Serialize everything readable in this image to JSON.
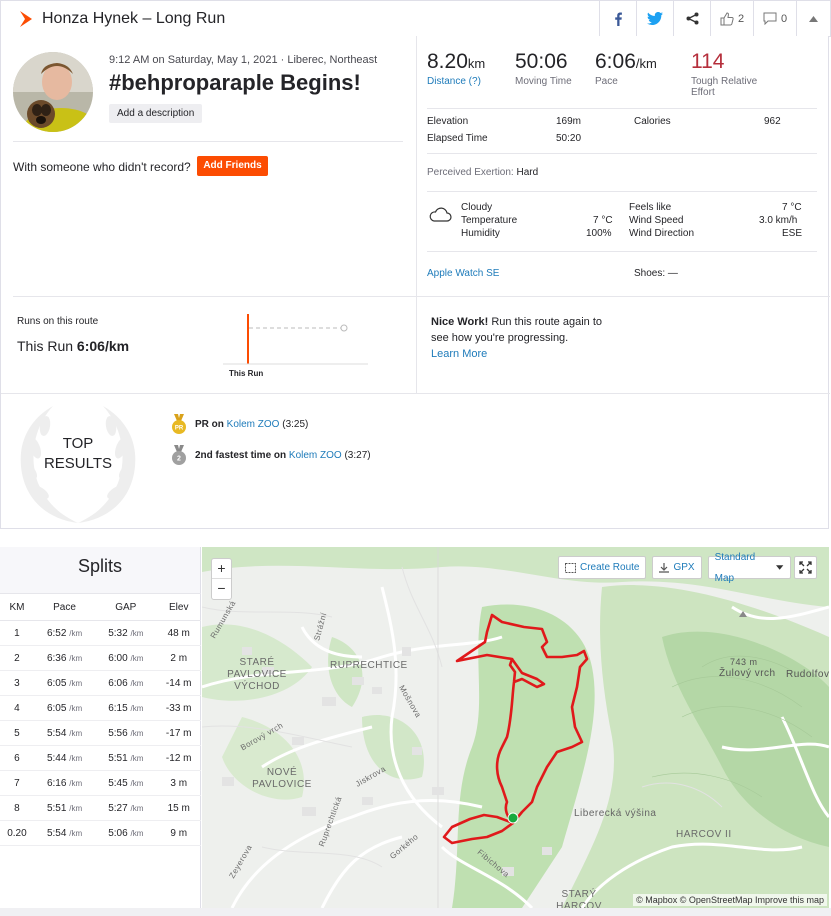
{
  "header": {
    "title": "Honza Hynek – Long Run",
    "kudos_count": "2",
    "comments_count": "0"
  },
  "activity": {
    "meta": "9:12 AM on Saturday, May 1, 2021 · Liberec, Northeast",
    "name": "#behproparaple Begins!",
    "add_description": "Add a description",
    "with_someone": "With someone who didn't record?",
    "add_friends": "Add Friends"
  },
  "stats": {
    "distance_value": "8.20",
    "distance_unit": "km",
    "distance_label": "Distance (?)",
    "moving_time_value": "50:06",
    "moving_time_label": "Moving Time",
    "pace_value": "6:06",
    "pace_unit": "/km",
    "pace_label": "Pace",
    "effort_value": "114",
    "effort_label_1": "Tough Relative",
    "effort_label_2": "Effort"
  },
  "details": {
    "elevation_label": "Elevation",
    "elevation_value": "169m",
    "calories_label": "Calories",
    "calories_value": "962",
    "elapsed_label": "Elapsed Time",
    "elapsed_value": "50:20",
    "perceived_label": "Perceived Exertion:",
    "perceived_value": "Hard"
  },
  "weather": {
    "condition": "Cloudy",
    "temperature_label": "Temperature",
    "temperature_value": "7 °C",
    "humidity_label": "Humidity",
    "humidity_value": "100%",
    "feels_like_label": "Feels like",
    "feels_like_value": "7 °C",
    "wind_speed_label": "Wind Speed",
    "wind_speed_value": "3.0 km/h",
    "wind_dir_label": "Wind Direction",
    "wind_dir_value": "ESE"
  },
  "device": {
    "name": "Apple Watch SE",
    "shoes_label": "Shoes: —"
  },
  "route": {
    "title": "Runs on this route",
    "this_run_prefix": "This Run",
    "this_run_pace": "6:06/km",
    "chart_label": "This Run",
    "nice_bold": "Nice Work!",
    "nice_text": " Run this route again to see how you're progressing.",
    "learn_more": "Learn More"
  },
  "top_results": {
    "line1": "TOP",
    "line2": "RESULTS",
    "items": [
      {
        "badge": "PR",
        "prefix": "PR on ",
        "segment": "Kolem ZOO",
        "time": " (3:25)"
      },
      {
        "badge": "2",
        "prefix": "2nd fastest time on ",
        "segment": "Kolem ZOO",
        "time": " (3:27)"
      }
    ]
  },
  "splits": {
    "title": "Splits",
    "headers": [
      "KM",
      "Pace",
      "GAP",
      "Elev"
    ],
    "rows": [
      {
        "km": "1",
        "pace": "6:52",
        "gap": "5:32",
        "elev": "48 m"
      },
      {
        "km": "2",
        "pace": "6:36",
        "gap": "6:00",
        "elev": "2 m"
      },
      {
        "km": "3",
        "pace": "6:05",
        "gap": "6:06",
        "elev": "-14 m"
      },
      {
        "km": "4",
        "pace": "6:05",
        "gap": "6:15",
        "elev": "-33 m"
      },
      {
        "km": "5",
        "pace": "5:54",
        "gap": "5:56",
        "elev": "-17 m"
      },
      {
        "km": "6",
        "pace": "5:44",
        "gap": "5:51",
        "elev": "-12 m"
      },
      {
        "km": "7",
        "pace": "6:16",
        "gap": "5:45",
        "elev": "3 m"
      },
      {
        "km": "8",
        "pace": "5:51",
        "gap": "5:27",
        "elev": "15 m"
      },
      {
        "km": "0.20",
        "pace": "5:54",
        "gap": "5:06",
        "elev": "9 m"
      }
    ],
    "unit": "/km"
  },
  "map": {
    "create_route": "Create Route",
    "gpx": "GPX",
    "standard_map": "Standard Map",
    "attribution": "© Mapbox © OpenStreetMap Improve this map",
    "labels": {
      "ruprechtice": "RUPRECHTICE",
      "stare_pavlovice": "STARÉ PAVLOVICE VÝCHOD",
      "nove_pavlovice": "NOVÉ PAVLOVICE",
      "zulovy_elev": "743 m",
      "zulovy": "Žulový vrch",
      "rudolfov": "Rudolfov",
      "liberecka": "Liberecká výšina",
      "harcov": "HARCOV II",
      "stary_harcov": "STARÝ HARCOV",
      "borovy": "Borový vrch",
      "jiskrova": "Jiskrova",
      "gorkeho": "Gorkého",
      "fibichova": "Fibichova",
      "mozartova": "Mošnova",
      "strazni": "Strážní",
      "rumunska": "Rumunská",
      "zeyerova": "Zeyerova",
      "ruprechticka": "Ruprechtická"
    }
  },
  "colors": {
    "strava_orange": "#fc4c02",
    "link_blue": "#1e7bba",
    "effort_red": "#b52e3b",
    "route_red": "#e0191b"
  }
}
